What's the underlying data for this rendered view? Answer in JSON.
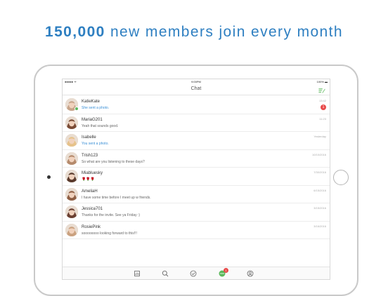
{
  "headline": {
    "number": "150,000",
    "rest": " new members join every month"
  },
  "statusbar": {
    "carrier": "●●●●● ᯤ",
    "time": "9:00PM",
    "battery": "100% ▬"
  },
  "navbar": {
    "title": "Chat",
    "compose_icon": "compose-icon"
  },
  "conversations": [
    {
      "name": "KatieKate",
      "message": "She sent a photo.",
      "time": "13:42",
      "message_highlight": true,
      "online": true,
      "unread": "1",
      "avatar_color": "#c7a48a"
    },
    {
      "name": "MariaG201",
      "message": "Yeah that sounds good.",
      "time": "11:23",
      "message_highlight": false,
      "online": false,
      "unread": "",
      "avatar_color": "#7a4b35"
    },
    {
      "name": "Isabelle",
      "message": "You sent a photo.",
      "time": "Yesterday",
      "message_highlight": true,
      "online": false,
      "unread": "",
      "avatar_color": "#e6c28a"
    },
    {
      "name": "Trish123",
      "message": "So what are you listening to these days?",
      "time": "10/10/2016",
      "message_highlight": false,
      "online": false,
      "unread": "",
      "avatar_color": "#b58a6c"
    },
    {
      "name": "Miabluesky",
      "message": "🌹🌹🌹",
      "time": "7/30/2016",
      "message_highlight": false,
      "online": false,
      "unread": "",
      "avatar_color": "#5a3a2c"
    },
    {
      "name": "AmeliaH",
      "message": "I have some time before I meet up w friends.",
      "time": "6/15/2016",
      "message_highlight": false,
      "online": false,
      "unread": "",
      "avatar_color": "#8f5f44"
    },
    {
      "name": "Jessica701",
      "message": "Thanks for the invite. See ya Friday :)",
      "time": "3/15/2016",
      "message_highlight": false,
      "online": false,
      "unread": "",
      "avatar_color": "#6b4032"
    },
    {
      "name": "RosiePink",
      "message": "soooooooo looking forward to this!!!",
      "time": "3/16/2016",
      "message_highlight": false,
      "online": false,
      "unread": "",
      "avatar_color": "#caa17f"
    }
  ],
  "tabbar": {
    "tabs": [
      {
        "icon": "grid-icon",
        "active": false
      },
      {
        "icon": "search-icon",
        "active": false
      },
      {
        "icon": "check-circle-icon",
        "active": false
      },
      {
        "icon": "chat-bubble-icon",
        "active": true,
        "badge": "1"
      },
      {
        "icon": "profile-icon",
        "active": false
      }
    ]
  },
  "colors": {
    "headline": "#2e7fc1",
    "accent_green": "#5cb85c",
    "badge_red": "#e84a4a",
    "link_blue": "#3a8fd6"
  }
}
